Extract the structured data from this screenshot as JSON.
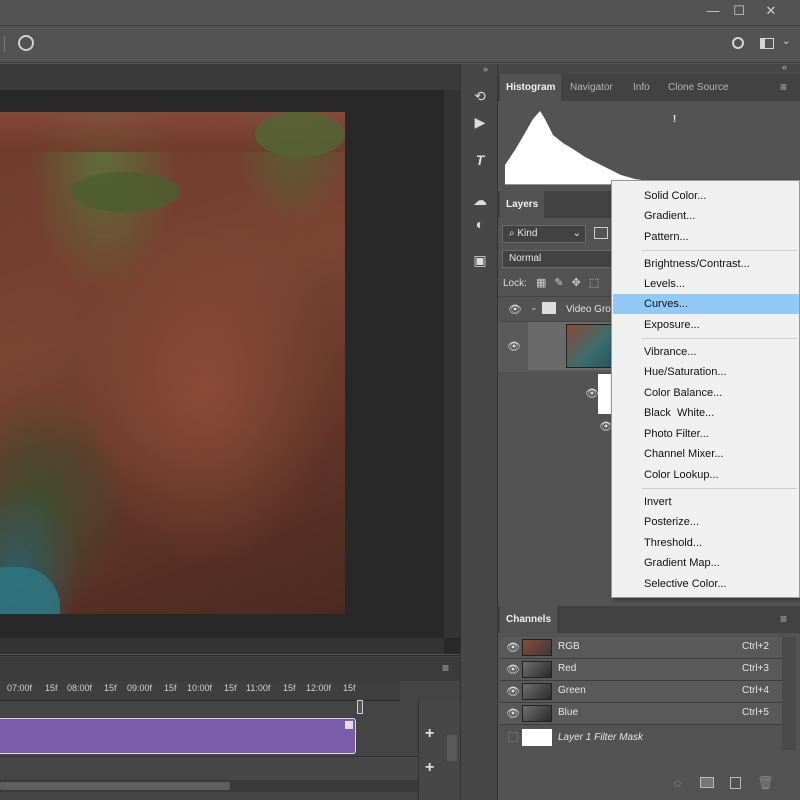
{
  "window": {
    "minimize": "—",
    "maximize": "☐",
    "close": "✕"
  },
  "histogram_panel": {
    "tabs": [
      "Histogram",
      "Navigator",
      "Info",
      "Clone Source"
    ],
    "warning": "!"
  },
  "layers_panel": {
    "tab": "Layers",
    "kind_filter": "Kind",
    "blend_mode": "Normal",
    "lock_label": "Lock:",
    "video_group": "Video Grou"
  },
  "channels_panel": {
    "tab": "Channels",
    "rows": [
      {
        "name": "RGB",
        "shortcut": "Ctrl+2"
      },
      {
        "name": "Red",
        "shortcut": "Ctrl+3"
      },
      {
        "name": "Green",
        "shortcut": "Ctrl+4"
      },
      {
        "name": "Blue",
        "shortcut": "Ctrl+5"
      }
    ],
    "mask": "Layer 1 Filter Mask"
  },
  "timeline": {
    "ticks": [
      "07:00f",
      "15f",
      "08:00f",
      "15f",
      "09:00f",
      "15f",
      "10:00f",
      "15f",
      "11:00f",
      "15f",
      "12:00f",
      "15f"
    ],
    "add": "+"
  },
  "adjustment_menu": {
    "groups": [
      [
        "Solid Color...",
        "Gradient...",
        "Pattern..."
      ],
      [
        "Brightness/Contrast...",
        "Levels...",
        "Curves...",
        "Exposure..."
      ],
      [
        "Vibrance...",
        "Hue/Saturation...",
        "Color Balance...",
        "Black  White...",
        "Photo Filter...",
        "Channel Mixer...",
        "Color Lookup..."
      ],
      [
        "Invert",
        "Posterize...",
        "Threshold...",
        "Gradient Map...",
        "Selective Color..."
      ]
    ],
    "highlighted": "Curves..."
  },
  "colors": {
    "accent_highlight": "#91c9f7",
    "clip": "#7a5cab"
  }
}
